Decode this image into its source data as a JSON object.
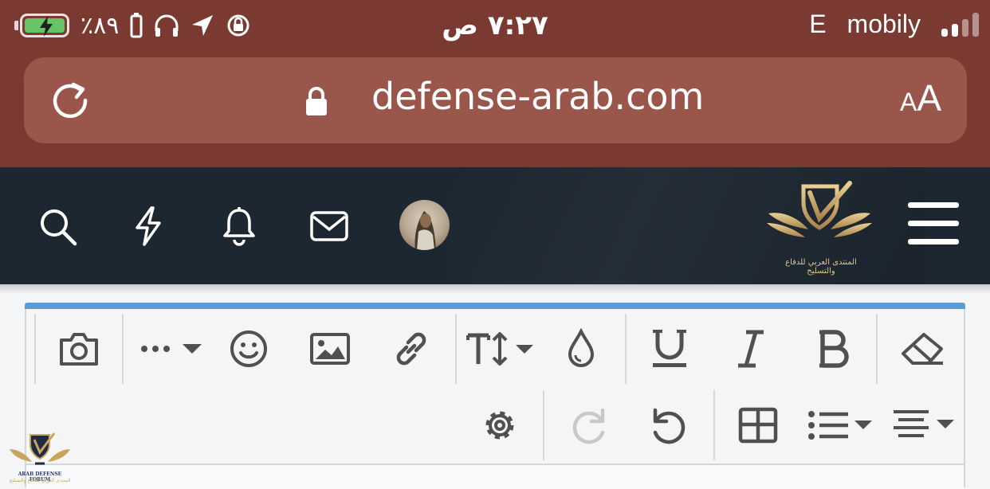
{
  "status_bar": {
    "battery_percent": "٪٨٩",
    "time": "٧:٢٧ ص",
    "network": "E",
    "carrier": "mobily",
    "signal_bars": 2
  },
  "browser": {
    "url": "defense-arab.com",
    "text_size_label_small": "A",
    "text_size_label_large": "A"
  },
  "site_header": {
    "logo_caption": "المنتدى العربي للدفاع والتسليح"
  },
  "editor_toolbar": {
    "row1": [
      "eraser-icon",
      "bold-icon",
      "italic-icon",
      "underline-icon",
      "color-drop-icon",
      "text-size-icon",
      "link-icon",
      "image-icon",
      "smiley-icon",
      "more-icon",
      "camera-icon"
    ],
    "row2": [
      "align-icon",
      "list-icon",
      "table-icon",
      "undo-icon",
      "redo-icon",
      "settings-icon"
    ]
  },
  "watermark": {
    "line1": "ARAB DEFENSE FORUM",
    "line2": "المنتدى العربي للدفاع والتسليح"
  }
}
